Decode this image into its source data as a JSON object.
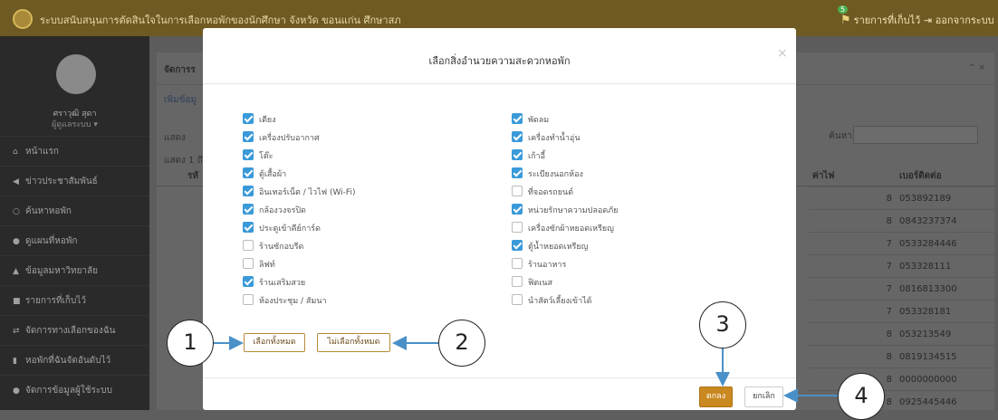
{
  "topbar": {
    "title": "ระบบสนับสนุนการตัดสินใจในการเลือกหอพักของนักศึกษา จังหวัด ขอนแก่น ศึกษาสภ",
    "saved_label": "รายการที่เก็บไว้",
    "saved_count": "5",
    "logout_label": "ออกจากระบบ"
  },
  "sidebar": {
    "user_name": "ศราวุฒิ สุดา",
    "user_role": "ผู้ดูแลระบบ ▾",
    "items": [
      {
        "icon": "home-icon",
        "glyph": "⌂",
        "label": "หน้าแรก"
      },
      {
        "icon": "megaphone-icon",
        "glyph": "◀",
        "label": "ข่าวประชาสัมพันธ์"
      },
      {
        "icon": "search-icon",
        "glyph": "○",
        "label": "ค้นหาหอพัก"
      },
      {
        "icon": "map-marker-icon",
        "glyph": "●",
        "label": "ดูแผนที่หอพัก"
      },
      {
        "icon": "graduation-cap-icon",
        "glyph": "▲",
        "label": "ข้อมูลมหาวิทยาลัย"
      },
      {
        "icon": "bookmark-icon",
        "glyph": "■",
        "label": "รายการที่เก็บไว้"
      },
      {
        "icon": "exchange-icon",
        "glyph": "⇄",
        "label": "จัดการทางเลือกของฉัน"
      },
      {
        "icon": "bar-chart-icon",
        "glyph": "▮",
        "label": "หอพักที่ฉันจัดอันดับไว้"
      },
      {
        "icon": "user-icon",
        "glyph": "●",
        "label": "จัดการข้อมูลผู้ใช้ระบบ"
      }
    ]
  },
  "background": {
    "panel_title": "จัดการร",
    "add_link": "เพิ่มข้อมู",
    "show_label": "แสดง",
    "showing_label": "แสดง 1 ถึ",
    "search_label": "ค้นหา:",
    "col_first": "รหั",
    "col_electric": "ค่าไฟ",
    "col_phone": "เบอร์ติดต่อ",
    "rows": [
      {
        "electric": "8",
        "phone": "053892189"
      },
      {
        "electric": "8",
        "phone": "0843237374"
      },
      {
        "electric": "7",
        "phone": "0533284446"
      },
      {
        "electric": "7",
        "phone": "053328111"
      },
      {
        "electric": "7",
        "phone": "0816813300"
      },
      {
        "electric": "7",
        "phone": "053328181"
      },
      {
        "electric": "8",
        "phone": "053213549"
      },
      {
        "electric": "8",
        "phone": "0819134515"
      },
      {
        "electric": "8",
        "phone": "0000000000"
      },
      {
        "electric": "8",
        "phone": "0925445446"
      }
    ]
  },
  "modal": {
    "title": "เลือกสิ่งอำนวยความสะดวกหอพัก",
    "close_glyph": "×",
    "left_options": [
      {
        "label": "เตียง",
        "checked": true
      },
      {
        "label": "เครื่องปรับอากาศ",
        "checked": true
      },
      {
        "label": "โต๊ะ",
        "checked": true
      },
      {
        "label": "ตู้เสื้อผ้า",
        "checked": true
      },
      {
        "label": "อินเทอร์เน็ต / ไวไฟ (Wi-Fi)",
        "checked": true
      },
      {
        "label": "กล้องวงจรปิด",
        "checked": true
      },
      {
        "label": "ประตูเข้าคีย์การ์ด",
        "checked": true
      },
      {
        "label": "ร้านซักอบรีด",
        "checked": false
      },
      {
        "label": "ลิฟท์",
        "checked": false
      },
      {
        "label": "ร้านเสริมสวย",
        "checked": true
      },
      {
        "label": "ห้องประชุม / สัมนา",
        "checked": false
      }
    ],
    "right_options": [
      {
        "label": "พัดลม",
        "checked": true
      },
      {
        "label": "เครื่องทำน้ำอุ่น",
        "checked": true
      },
      {
        "label": "เก้าอี้",
        "checked": true
      },
      {
        "label": "ระเบียงนอกห้อง",
        "checked": true
      },
      {
        "label": "ที่จอดรถยนต์",
        "checked": false
      },
      {
        "label": "หน่วยรักษาความปลอดภัย",
        "checked": true
      },
      {
        "label": "เครื่องซักผ้าหยอดเหรียญ",
        "checked": false
      },
      {
        "label": "ตู้น้ำหยอดเหรียญ",
        "checked": true
      },
      {
        "label": "ร้านอาหาร",
        "checked": false
      },
      {
        "label": "ฟิตเนส",
        "checked": false
      },
      {
        "label": "นำสัตว์เลี้ยงเข้าได้",
        "checked": false
      }
    ],
    "select_all_label": "เลือกทั้งหมด",
    "deselect_all_label": "ไม่เลือกทั้งหมด",
    "ok_label": "ตกลง",
    "cancel_label": "ยกเลิก"
  },
  "callouts": [
    "1",
    "2",
    "3",
    "4"
  ],
  "colors": {
    "accent": "#c98820",
    "checkbox": "#3a9ad9",
    "arrow": "#4a90c8"
  }
}
